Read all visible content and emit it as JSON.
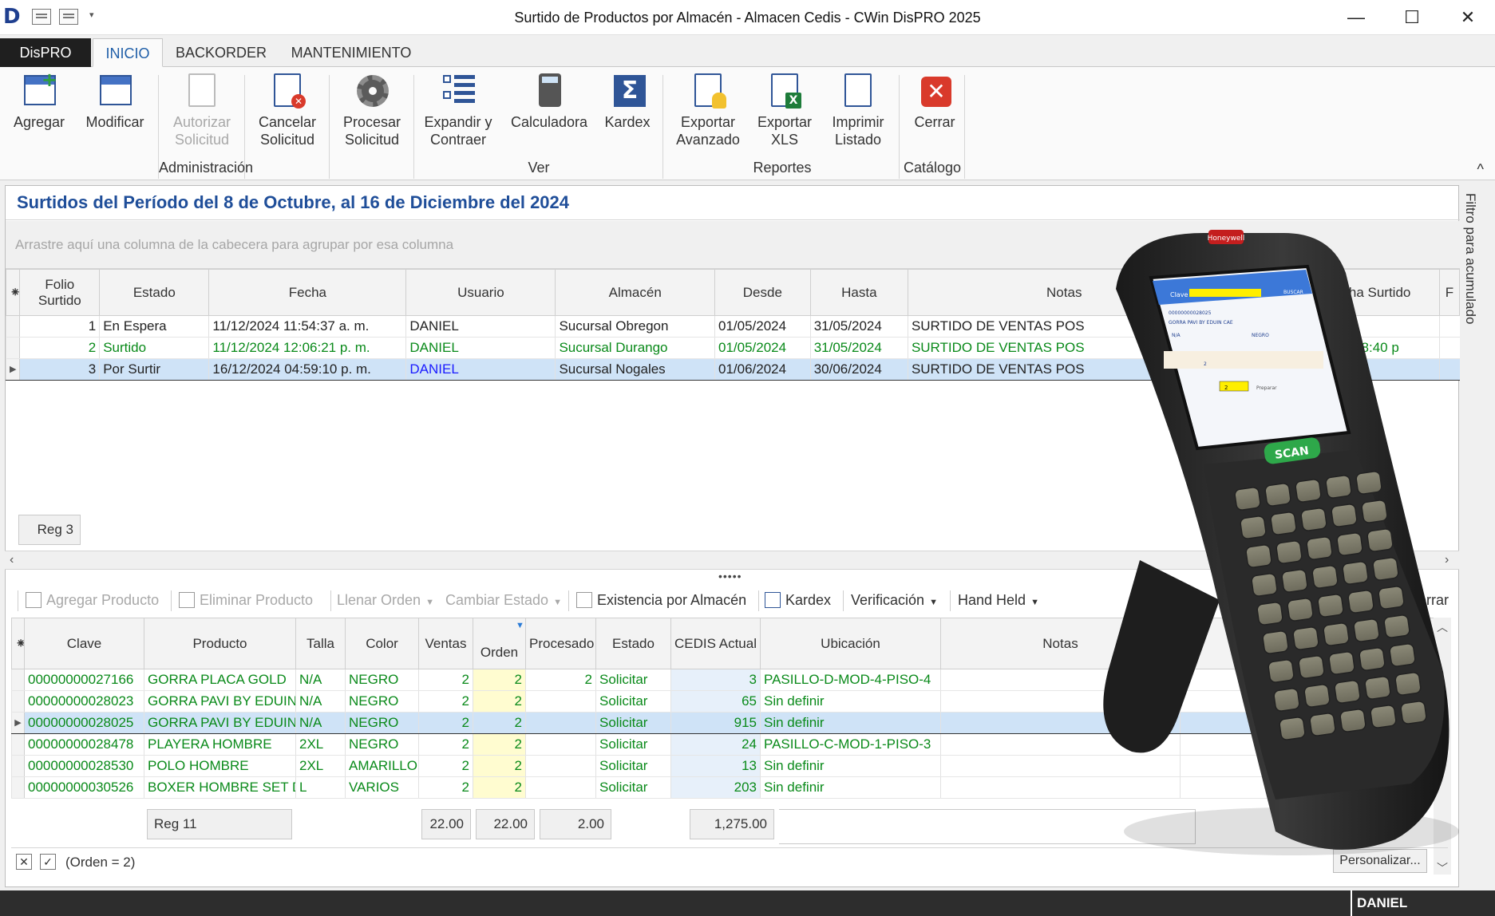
{
  "window": {
    "title": "Surtido de Productos por Almacén - Almacen Cedis - CWin DisPRO 2025",
    "minimize": "—",
    "maximize": "☐",
    "close": "✕"
  },
  "tabs": [
    "DisPRO",
    "INICIO",
    "BACKORDER",
    "MANTENIMIENTO"
  ],
  "ribbon": {
    "buttons": [
      "Agregar",
      "Modificar",
      "Autorizar\nSolicitud",
      "Cancelar\nSolicitud",
      "Procesar\nSolicitud",
      "Expandir y\nContraer",
      "Calculadora",
      "Kardex",
      "Exportar\nAvanzado",
      "Exportar\nXLS",
      "Imprimir\nListado",
      "Cerrar"
    ],
    "groups": [
      "Administración",
      "Ver",
      "Reportes",
      "Catálogo"
    ],
    "collapse": "^"
  },
  "panel": {
    "title": "Surtidos del Período del 8 de Octubre, al 16 de Diciembre del 2024",
    "group_hint": "Arrastre aquí una columna de la cabecera para agrupar por esa columna",
    "side_tab": "Filtro para acumulado"
  },
  "upper_grid": {
    "columns": [
      "Folio\nSurtido",
      "Estado",
      "Fecha",
      "Usuario",
      "Almacén",
      "Desde",
      "Hasta",
      "Notas",
      "ha Surtido",
      "F"
    ],
    "rows": [
      {
        "folio": "1",
        "estado": "En Espera",
        "fecha": "11/12/2024 11:54:37 a. m.",
        "usuario": "DANIEL",
        "almacen": "Sucursal Obregon",
        "desde": "01/05/2024",
        "hasta": "31/05/2024",
        "notas": "SURTIDO DE VENTAS POS",
        "surtido": ""
      },
      {
        "folio": "2",
        "estado": "Surtido",
        "fecha": "11/12/2024 12:06:21 p. m.",
        "usuario": "DANIEL",
        "almacen": "Sucursal Durango",
        "desde": "01/05/2024",
        "hasta": "31/05/2024",
        "notas": "SURTIDO DE VENTAS POS",
        "surtido": "4 12:48:40 p"
      },
      {
        "folio": "3",
        "estado": "Por Surtir",
        "fecha": "16/12/2024 04:59:10 p. m.",
        "usuario": "DANIEL",
        "almacen": "Sucursal Nogales",
        "desde": "01/06/2024",
        "hasta": "30/06/2024",
        "notas": "SURTIDO DE VENTAS POS",
        "surtido": ""
      }
    ],
    "footer": "Reg 3"
  },
  "toolbar": {
    "agregar": "Agregar Producto",
    "eliminar": "Eliminar Producto",
    "llenar": "Llenar Orden",
    "cambiar": "Cambiar Estado",
    "existencia": "Existencia por Almacén",
    "kardex": "Kardex",
    "verificacion": "Verificación",
    "handheld": "Hand Held",
    "cerrar": "Cerrar"
  },
  "lower_grid": {
    "columns": [
      "Clave",
      "Producto",
      "Talla",
      "Color",
      "Ventas",
      "Orden",
      "Procesado",
      "Estado",
      "CEDIS Actual",
      "Ubicación",
      "Notas"
    ],
    "rows": [
      {
        "clave": "00000000027166",
        "producto": "GORRA PLACA GOLD",
        "talla": "N/A",
        "color": "NEGRO",
        "ventas": "2",
        "orden": "2",
        "procesado": "2",
        "estado": "Solicitar",
        "cedis": "3",
        "ubicacion": "PASILLO-D-MOD-4-PISO-4"
      },
      {
        "clave": "00000000028023",
        "producto": "GORRA PAVI BY EDUIN C",
        "talla": "N/A",
        "color": "NEGRO",
        "ventas": "2",
        "orden": "2",
        "procesado": "",
        "estado": "Solicitar",
        "cedis": "65",
        "ubicacion": "Sin definir"
      },
      {
        "clave": "00000000028025",
        "producto": "GORRA PAVI BY EDUIN C",
        "talla": "N/A",
        "color": "NEGRO",
        "ventas": "2",
        "orden": "2",
        "procesado": "",
        "estado": "Solicitar",
        "cedis": "915",
        "ubicacion": "Sin definir"
      },
      {
        "clave": "00000000028478",
        "producto": "PLAYERA HOMBRE",
        "talla": "2XL",
        "color": "NEGRO",
        "ventas": "2",
        "orden": "2",
        "procesado": "",
        "estado": "Solicitar",
        "cedis": "24",
        "ubicacion": "PASILLO-C-MOD-1-PISO-3"
      },
      {
        "clave": "00000000028530",
        "producto": "POLO HOMBRE",
        "talla": "2XL",
        "color": "AMARILLO",
        "ventas": "2",
        "orden": "2",
        "procesado": "",
        "estado": "Solicitar",
        "cedis": "13",
        "ubicacion": "Sin definir"
      },
      {
        "clave": "00000000030526",
        "producto": "BOXER HOMBRE SET DE",
        "talla": "L",
        "color": "VARIOS",
        "ventas": "2",
        "orden": "2",
        "procesado": "",
        "estado": "Solicitar",
        "cedis": "203",
        "ubicacion": "Sin definir"
      }
    ],
    "footer": {
      "reg": "Reg 11",
      "ventas": "22.00",
      "orden": "22.00",
      "procesado": "2.00",
      "cedis": "1,275.00"
    }
  },
  "filter": {
    "text": "(Orden = 2)",
    "clear": "✕",
    "check": "✓",
    "customize": "Personalizar..."
  },
  "status": {
    "user": "DANIEL"
  },
  "device": {
    "brand": "Honeywell",
    "scan_key": "SCAN",
    "screen": {
      "clave_label": "Clave",
      "buscar": "BUSCAR",
      "clave_value": "00000000028025",
      "producto": "GORRA PAVI BY EDUIN CAE",
      "talla": "N/A",
      "color": "NEGRO",
      "cantidad": "2",
      "preparar": "Preparar",
      "qty": "2"
    }
  },
  "colors": {
    "accent": "#1f5ea8",
    "title_blue": "#1f4e99",
    "green_text": "#0a8a1a",
    "selection": "#cfe3f7"
  }
}
